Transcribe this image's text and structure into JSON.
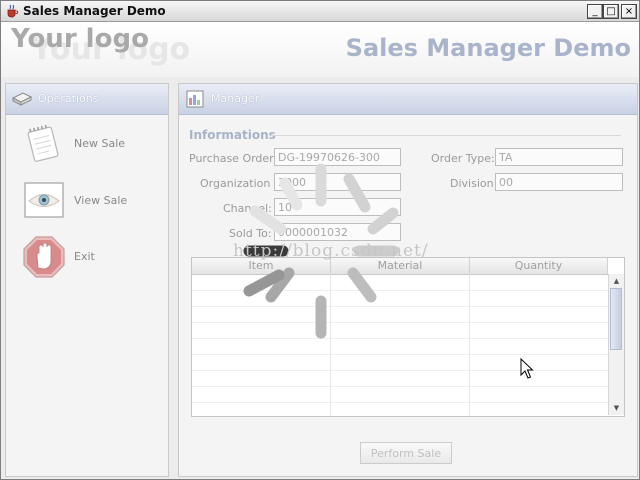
{
  "window": {
    "title": "Sales Manager Demo",
    "controls": {
      "minimize": "_",
      "maximize": "□",
      "close": "×"
    }
  },
  "header": {
    "logo_text": "Your logo",
    "app_heading": "Sales Manager Demo"
  },
  "operations": {
    "title": "Operations",
    "items": [
      {
        "label": "New Sale",
        "icon": "notepad-icon"
      },
      {
        "label": "View Sale",
        "icon": "eye-icon"
      },
      {
        "label": "Exit",
        "icon": "stop-hand-icon"
      }
    ]
  },
  "manager": {
    "title": "Manager",
    "section_title": "Informations",
    "fields": {
      "purchase_order": {
        "label": "Purchase Order:",
        "value": "DG-19970626-300"
      },
      "order_type": {
        "label": "Order Type:",
        "value": "TA"
      },
      "organization": {
        "label": "Organization :",
        "value": "3000"
      },
      "division": {
        "label": "Division:",
        "value": "00"
      },
      "channel": {
        "label": "Channel:",
        "value": "10"
      },
      "sold_to": {
        "label": "Sold To:",
        "value": "0000001032"
      }
    },
    "table": {
      "columns": [
        "Item",
        "Material",
        "Quantity"
      ],
      "rows": []
    },
    "perform_button": "Perform Sale"
  },
  "overlay": {
    "watermark": "http://blog.csdn.net/",
    "spinner": "loading-spinner-icon"
  },
  "colors": {
    "panel_header": "#c9d1e4",
    "heading_text": "#a9b4cc",
    "section_text": "#a8b3c8"
  }
}
